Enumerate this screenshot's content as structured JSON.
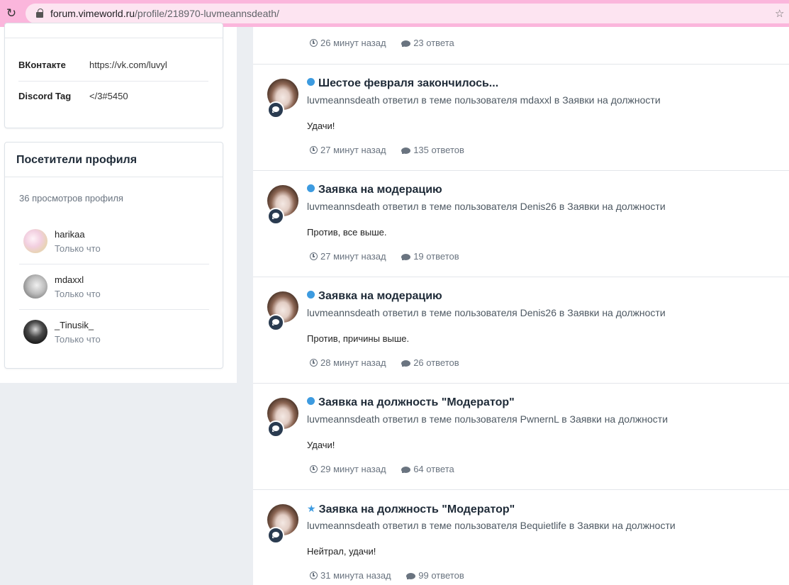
{
  "browser": {
    "url_host": "forum.vimeworld.ru",
    "url_path": "/profile/218970-luvmeannsdeath/"
  },
  "profile_info": {
    "rows": [
      {
        "label": "ВКонтакте",
        "value": "https://vk.com/luvyl"
      },
      {
        "label": "Discord Tag",
        "value": "</3#5450"
      }
    ]
  },
  "visitors": {
    "title": "Посетители профиля",
    "views": "36 просмотров профиля",
    "items": [
      {
        "name": "harikaa",
        "time": "Только что"
      },
      {
        "name": "mdaxxl",
        "time": "Только что"
      },
      {
        "name": "_Tinusik_",
        "time": "Только что"
      }
    ]
  },
  "feed": {
    "top": {
      "time": "26 минут назад",
      "replies": "23 ответа"
    },
    "entries": [
      {
        "title": "Шестое февраля закончилось...",
        "marker": "dot",
        "user": "luvmeannsdeath",
        "mid": "ответил в теме пользователя",
        "author": "mdaxxl",
        "in": "в",
        "forum": "Заявки на должности",
        "text": "Удачи!",
        "time": "27 минут назад",
        "replies": "135 ответов"
      },
      {
        "title": "Заявка на модерацию",
        "marker": "dot",
        "user": "luvmeannsdeath",
        "mid": "ответил в теме пользователя",
        "author": "Denis26",
        "in": "в",
        "forum": "Заявки на должности",
        "text": "Против, все выше.",
        "time": "27 минут назад",
        "replies": "19 ответов"
      },
      {
        "title": "Заявка на модерацию",
        "marker": "dot",
        "user": "luvmeannsdeath",
        "mid": "ответил в теме пользователя",
        "author": "Denis26",
        "in": "в",
        "forum": "Заявки на должности",
        "text": "Против, причины выше.",
        "time": "28 минут назад",
        "replies": "26 ответов"
      },
      {
        "title": "Заявка на должность \"Модератор\"",
        "marker": "dot",
        "user": "luvmeannsdeath",
        "mid": "ответил в теме пользователя",
        "author": "PwnernL",
        "in": "в",
        "forum": "Заявки на должности",
        "text": "Удачи!",
        "time": "29 минут назад",
        "replies": "64 ответа"
      },
      {
        "title": "Заявка на должность \"Модератор\"",
        "marker": "star",
        "user": "luvmeannsdeath",
        "mid": "ответил в теме пользователя",
        "author": "Bequietlife",
        "in": "в",
        "forum": "Заявки на должности",
        "text": "Нейтрал, удачи!",
        "time": "31 минута назад",
        "replies": "99 ответов"
      }
    ]
  },
  "colors": {
    "browser_bar": "#fbb6dc",
    "accent": "#3d9be0",
    "title": "#1f2b38",
    "page_bg": "#ebeef2"
  }
}
